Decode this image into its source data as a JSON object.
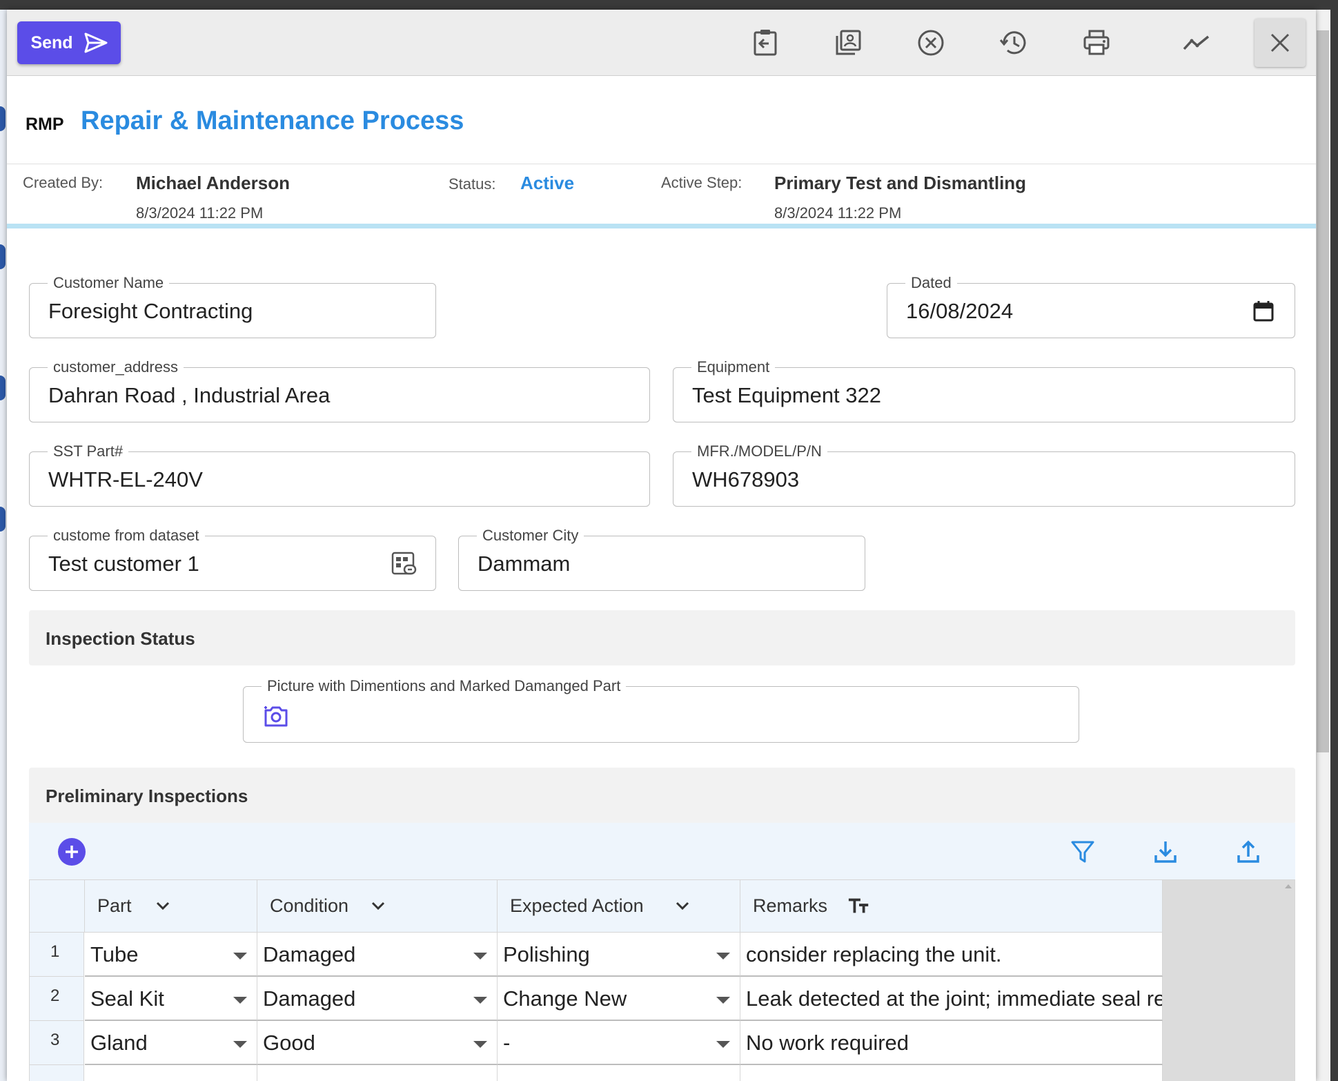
{
  "toolbar": {
    "send_label": "Send",
    "icons": [
      "return-icon",
      "gallery-icon",
      "cancel-circle-icon",
      "history-icon",
      "print-icon",
      "trend-icon",
      "close-icon"
    ]
  },
  "header": {
    "abbreviation": "RMP",
    "title": "Repair & Maintenance Process"
  },
  "meta": {
    "created_by_label": "Created By:",
    "created_by_value": "Michael Anderson",
    "created_date": "8/3/2024 11:22 PM",
    "status_label": "Status:",
    "status_value": "Active",
    "active_step_label": "Active Step:",
    "active_step_value": "Primary Test and Dismantling",
    "active_step_date": "8/3/2024 11:22 PM"
  },
  "form": {
    "customer_name": {
      "label": "Customer Name",
      "value": "Foresight Contracting"
    },
    "dated": {
      "label": "Dated",
      "value": "16/08/2024"
    },
    "customer_address": {
      "label": "customer_address",
      "value": "Dahran Road , Industrial Area"
    },
    "equipment": {
      "label": "Equipment",
      "value": "Test Equipment 322"
    },
    "sst_part": {
      "label": "SST Part#",
      "value": "WHTR-EL-240V"
    },
    "mfr_model": {
      "label": "MFR./MODEL/P/N",
      "value": "WH678903"
    },
    "customer_dataset": {
      "label": "custome from dataset",
      "value": "Test customer 1"
    },
    "customer_city": {
      "label": "Customer City",
      "value": "Dammam"
    }
  },
  "inspection_status": {
    "title": "Inspection Status",
    "picture_label": "Picture with Dimentions and Marked Damanged Part"
  },
  "preliminary": {
    "title": "Preliminary Inspections",
    "columns": [
      "Part",
      "Condition",
      "Expected Action",
      "Remarks"
    ],
    "rows": [
      {
        "num": "1",
        "part": "Tube",
        "condition": "Damaged",
        "action": "Polishing",
        "remarks": "consider replacing the unit."
      },
      {
        "num": "2",
        "part": "Seal Kit",
        "condition": "Damaged",
        "action": "Change New",
        "remarks": "Leak detected at the joint; immediate seal replacement"
      },
      {
        "num": "3",
        "part": "Gland",
        "condition": "Good",
        "action": "-",
        "remarks": "No work required"
      }
    ]
  },
  "colors": {
    "accent": "#5b4de8",
    "link_blue": "#2a8be0",
    "header_bg": "#ededed",
    "status_bar": "#b9e2f4"
  }
}
